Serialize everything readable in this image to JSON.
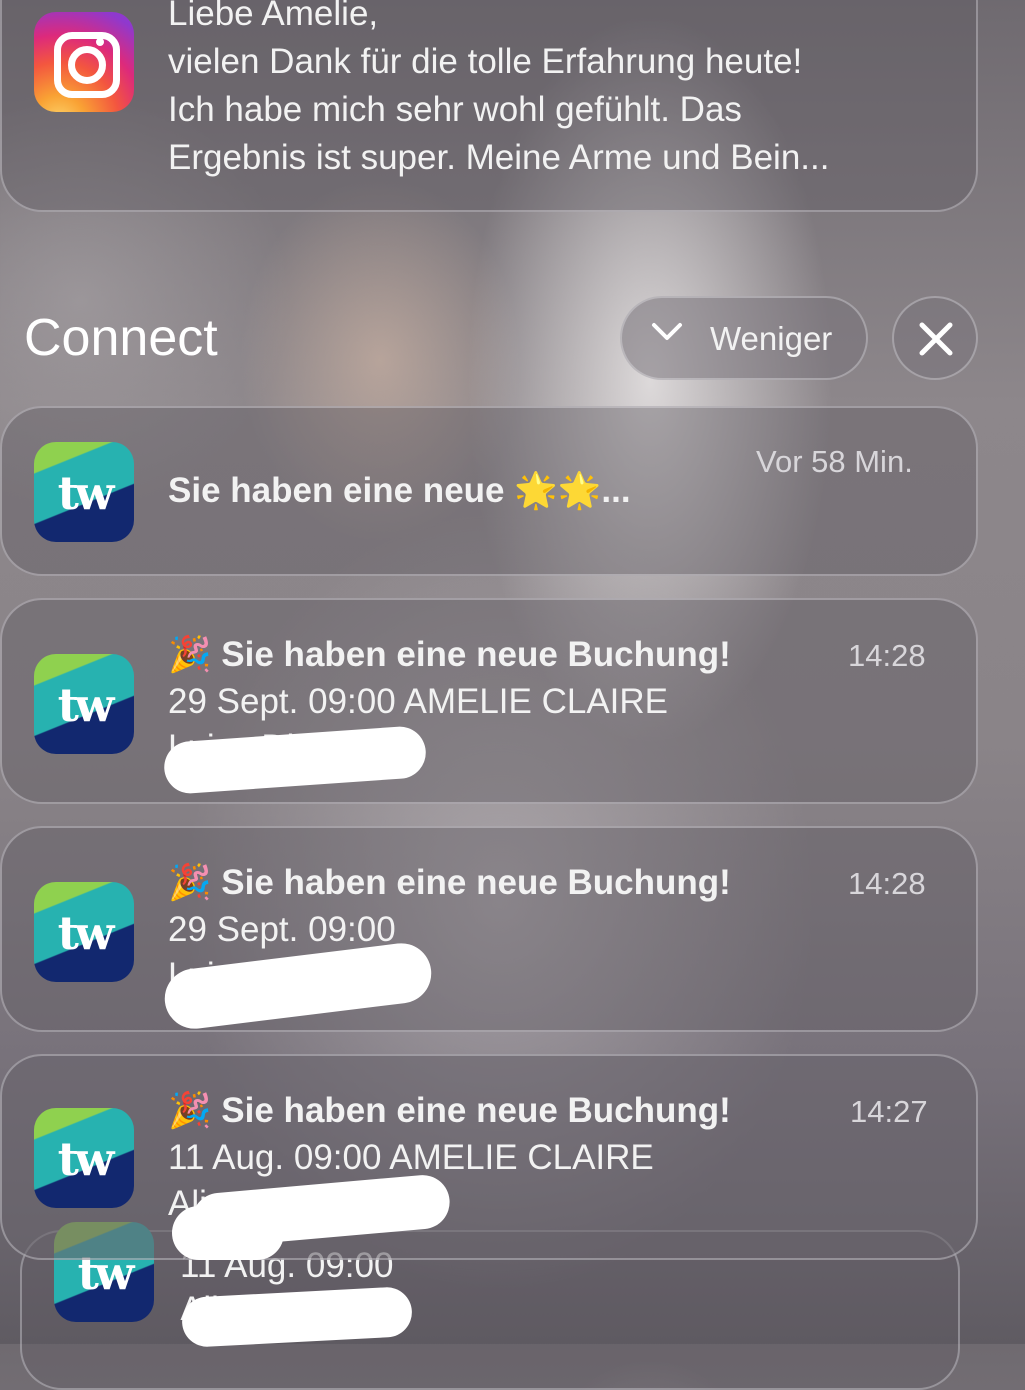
{
  "instagram_notification": {
    "icon": "instagram-icon",
    "lines": [
      "Liebe Amelie,",
      "vielen Dank für die tolle Erfahrung heute!",
      "Ich habe mich sehr wohl gefühlt. Das",
      "Ergebnis ist super. Meine Arme und Bein..."
    ]
  },
  "group": {
    "title": "Connect",
    "collapse_label": "Weniger",
    "collapse_icon": "chevron-down-icon",
    "close_icon": "close-icon",
    "close_glyph": "✕",
    "chevron_glyph": "⌄"
  },
  "notifications": [
    {
      "icon": "tw-app-icon",
      "icon_text": "tw",
      "title": "Sie haben eine neue 🌟🌟...",
      "time": "Vor 58 Min."
    },
    {
      "icon": "tw-app-icon",
      "icon_text": "tw",
      "title": "🎉 Sie haben eine neue Buchung!",
      "time": "14:28",
      "line1": "29 Sept. 09:00 AMELIE CLAIRE",
      "line2": "Luise Diet"
    },
    {
      "icon": "tw-app-icon",
      "icon_text": "tw",
      "title": "🎉 Sie haben eine neue Buchung!",
      "time": "14:28",
      "line1": "29 Sept. 09:00",
      "line2": "Luise Di"
    },
    {
      "icon": "tw-app-icon",
      "icon_text": "tw",
      "title": "🎉 Sie haben eine neue Buchung!",
      "time": "14:27",
      "line1": "11 Aug. 09:00 AMELIE CLAIRE",
      "line2": "Ali"
    },
    {
      "icon": "tw-app-icon",
      "icon_text": "tw",
      "line1": "11 Aug. 09:00",
      "line2": "Alina Sch"
    }
  ]
}
